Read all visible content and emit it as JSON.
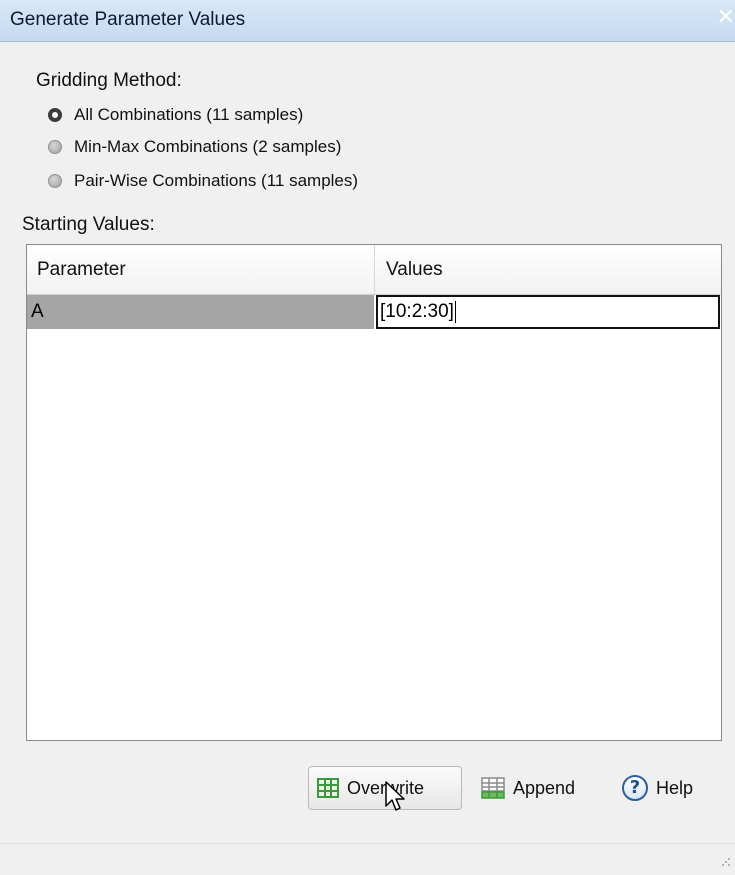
{
  "window": {
    "title": "Generate Parameter Values",
    "close_glyph": "✕"
  },
  "gridding": {
    "label": "Gridding Method:",
    "options": [
      {
        "label": "All Combinations (11 samples)",
        "selected": true
      },
      {
        "label": "Min-Max Combinations (2 samples)",
        "selected": false
      },
      {
        "label": "Pair-Wise Combinations (11 samples)",
        "selected": false
      }
    ]
  },
  "starting_values": {
    "label": "Starting Values:",
    "columns": [
      "Parameter",
      "Values"
    ],
    "rows": [
      {
        "parameter": "A",
        "values": "[10:2:30]"
      }
    ]
  },
  "buttons": {
    "overwrite": "Overwrite",
    "append": "Append",
    "help": "Help"
  },
  "icons": {
    "overwrite": "table-grid-icon",
    "append": "table-append-icon",
    "help": "help-question-icon",
    "cursor": "mouse-pointer-icon",
    "grip": "resize-grip-icon"
  },
  "colors": {
    "titlebar": "#c5daf1",
    "selected_cell": "#a5a5a5",
    "grid_icon_green": "#3c9a3c"
  }
}
